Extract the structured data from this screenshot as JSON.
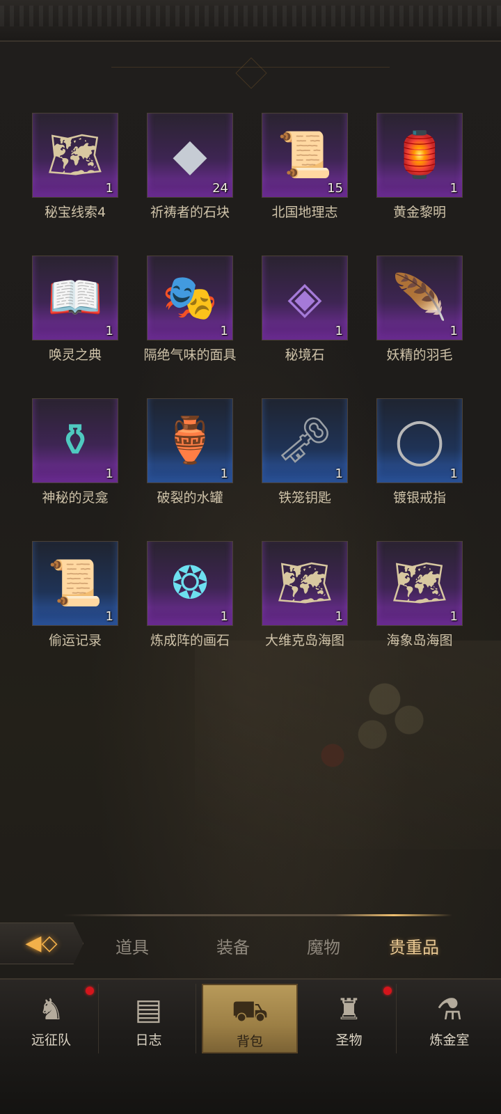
{
  "inventory": {
    "items": [
      {
        "name": "秘宝线索4",
        "count": "1",
        "rarity": "purple",
        "icon": "treasure-map-icon",
        "glyph": "🗺"
      },
      {
        "name": "祈祷者的石块",
        "count": "24",
        "rarity": "purple",
        "icon": "stone-icon",
        "glyph": "◆"
      },
      {
        "name": "北国地理志",
        "count": "15",
        "rarity": "purple",
        "icon": "scroll-icon",
        "glyph": "📜"
      },
      {
        "name": "黄金黎明",
        "count": "1",
        "rarity": "purple",
        "icon": "lantern-icon",
        "glyph": "🏮"
      },
      {
        "name": "唤灵之典",
        "count": "1",
        "rarity": "purple",
        "icon": "tome-icon",
        "glyph": "📖"
      },
      {
        "name": "隔绝气味的面具",
        "count": "1",
        "rarity": "purple",
        "icon": "mask-icon",
        "glyph": "🎭"
      },
      {
        "name": "秘境石",
        "count": "1",
        "rarity": "purple",
        "icon": "crystal-icon",
        "glyph": "◈"
      },
      {
        "name": "妖精的羽毛",
        "count": "1",
        "rarity": "purple",
        "icon": "feather-icon",
        "glyph": "🪶"
      },
      {
        "name": "神秘的灵龛",
        "count": "1",
        "rarity": "purple",
        "icon": "urn-icon",
        "glyph": "⚱"
      },
      {
        "name": "破裂的水罐",
        "count": "1",
        "rarity": "blue",
        "icon": "jar-icon",
        "glyph": "🏺"
      },
      {
        "name": "铁笼钥匙",
        "count": "1",
        "rarity": "blue",
        "icon": "key-icon",
        "glyph": "🗝"
      },
      {
        "name": "镀银戒指",
        "count": "1",
        "rarity": "blue",
        "icon": "ring-icon",
        "glyph": "◯"
      },
      {
        "name": "偷运记录",
        "count": "1",
        "rarity": "blue",
        "icon": "scroll-icon",
        "glyph": "📜"
      },
      {
        "name": "炼成阵的画石",
        "count": "1",
        "rarity": "purple",
        "icon": "rune-stone-icon",
        "glyph": "❂"
      },
      {
        "name": "大维克岛海图",
        "count": "1",
        "rarity": "purple",
        "icon": "sea-chart-icon",
        "glyph": "🗺"
      },
      {
        "name": "海象岛海图",
        "count": "1",
        "rarity": "purple",
        "icon": "sea-chart-icon",
        "glyph": "🗺"
      }
    ]
  },
  "tabs": {
    "items": [
      "道具",
      "装备",
      "魔物",
      "贵重品"
    ],
    "active": "贵重品"
  },
  "nav": {
    "items": [
      {
        "label": "远征队",
        "icon": "horned-helmet-icon",
        "badge": true
      },
      {
        "label": "日志",
        "icon": "journal-icon",
        "badge": false
      },
      {
        "label": "背包",
        "icon": "backpack-icon",
        "badge": false,
        "active": true
      },
      {
        "label": "圣物",
        "icon": "chalice-icon",
        "badge": true
      },
      {
        "label": "炼金室",
        "icon": "alchemy-icon",
        "badge": false
      }
    ]
  },
  "colors": {
    "purple_rarity": "#7a2fa6",
    "blue_rarity": "#2e5cb0",
    "active_tab_text": "#e8c893",
    "active_nav_bg": "#b89a5a",
    "badge": "#d4151c"
  }
}
